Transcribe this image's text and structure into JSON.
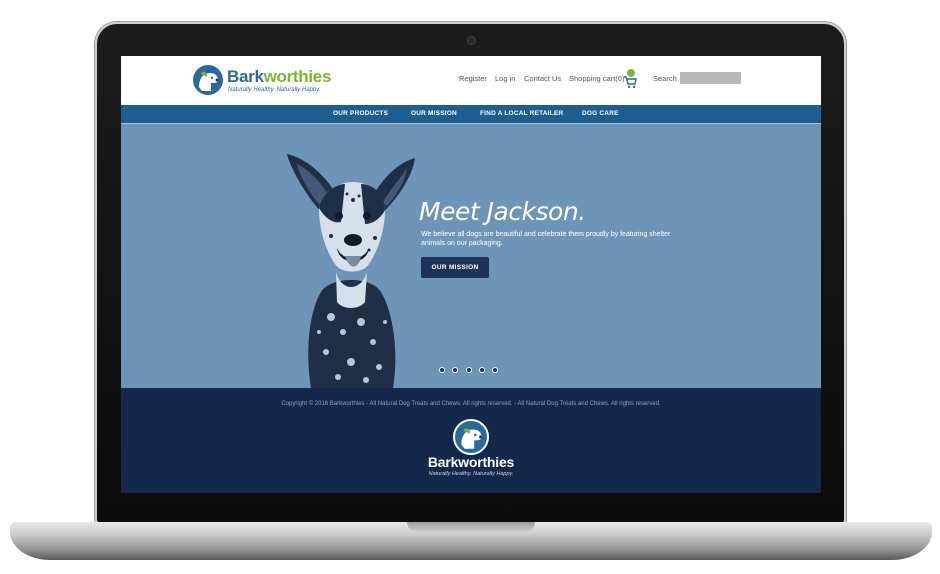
{
  "brand": {
    "name_part1": "Bark",
    "name_part2": "worthies",
    "tagline": "Naturally Healthy. Naturally Happy.",
    "primary_color": "#2a6a9a",
    "accent_color": "#7ab72e"
  },
  "header": {
    "links": {
      "register": "Register",
      "login": "Log in",
      "contact": "Contact Us",
      "cart": "Shopping cart(0)"
    },
    "cart_icon": "shopping-cart-icon",
    "search_label": "Search",
    "search_value": ""
  },
  "nav": {
    "items": [
      "OUR PRODUCTS",
      "OUR MISSION",
      "FIND A LOCAL RETAILER",
      "DOG CARE"
    ],
    "background": "#1c5f8f"
  },
  "hero": {
    "title": "Meet Jackson.",
    "text": "We believe all dogs are beautiful and celebrate them proudly by featuring shelter animals on our packaging.",
    "button": "OUR MISSION",
    "background": "#6e95b8",
    "slides": 5
  },
  "footer": {
    "copyright": "Copyright © 2016 Barkworthies - All Natural Dog Treats and Chews. All rights reserved. - All Natural Dog Treats and Chews. All rights reserved.",
    "logo_name": "Barkworthies",
    "logo_tagline": "Naturally Healthy. Naturally Happy.",
    "background": "#13284a"
  }
}
